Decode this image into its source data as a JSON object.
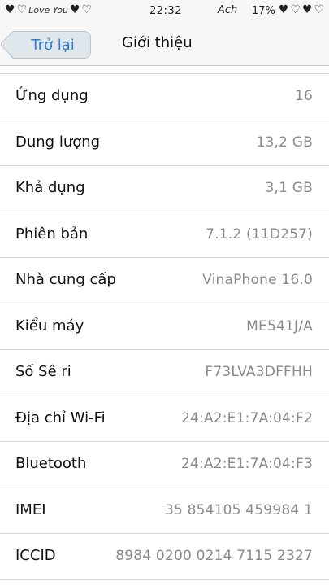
{
  "status_bar": {
    "time": "22:32",
    "carrier": "Ach",
    "battery": "17%",
    "left_decoration": "decorative-hearts-icon",
    "left_script": "Love You",
    "right_decoration": "decorative-hearts-icon"
  },
  "nav": {
    "back_label": "Trở lại",
    "title": "Giới thiệu",
    "accent_color": "#2a7fd4"
  },
  "rows": [
    {
      "label": "Ứng dụng",
      "value": "16"
    },
    {
      "label": "Dung lượng",
      "value": "13,2 GB"
    },
    {
      "label": "Khả dụng",
      "value": "3,1 GB"
    },
    {
      "label": "Phiên bản",
      "value": "7.1.2 (11D257)"
    },
    {
      "label": "Nhà cung cấp",
      "value": "VinaPhone 16.0"
    },
    {
      "label": "Kiểu máy",
      "value": "ME541J/A"
    },
    {
      "label": "Số Sê ri",
      "value": "F73LVA3DFFHH"
    },
    {
      "label": "Địa chỉ Wi-Fi",
      "value": "24:A2:E1:7A:04:F2"
    },
    {
      "label": "Bluetooth",
      "value": "24:A2:E1:7A:04:F3"
    },
    {
      "label": "IMEI",
      "value": "35 854105 459984 1"
    },
    {
      "label": "ICCID",
      "value": "8984 0200 0214 7115 2327"
    }
  ]
}
